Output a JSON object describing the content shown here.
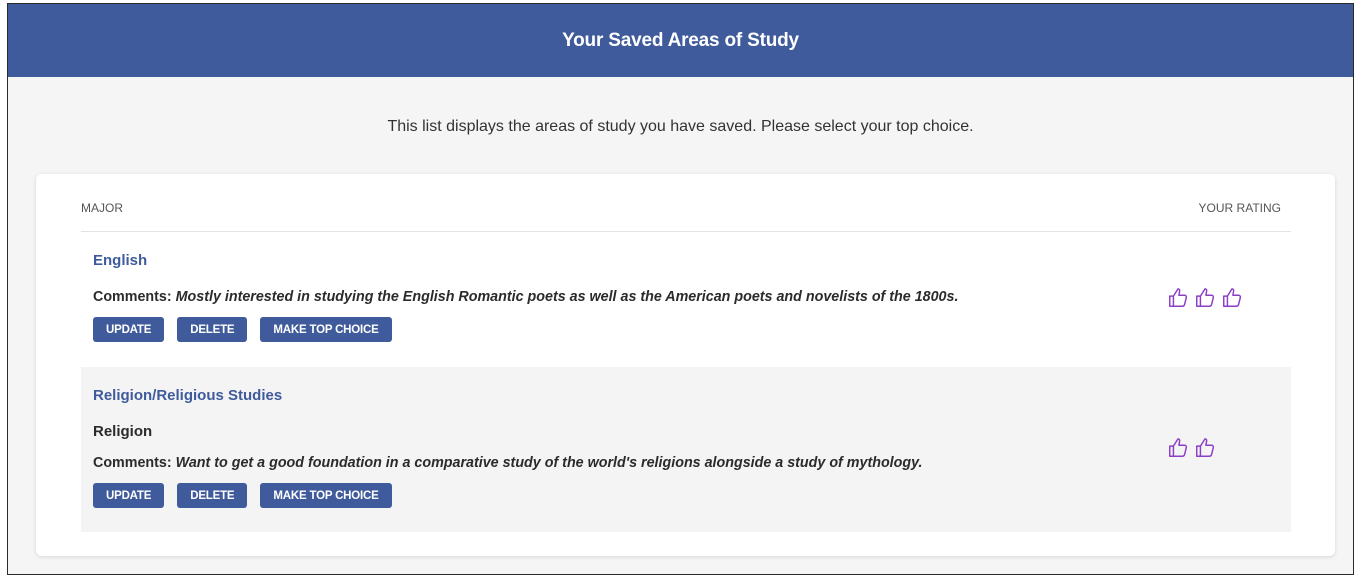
{
  "header": {
    "title": "Your Saved Areas of Study"
  },
  "intro": "This list displays the areas of study you have saved. Please select your top choice.",
  "table": {
    "col_major": "MAJOR",
    "col_rating": "YOUR RATING"
  },
  "rows": [
    {
      "major": "English",
      "comments_label": "Comments:",
      "comments": "Mostly interested in studying the English Romantic poets as well as the American poets and novelists of the 1800s.",
      "rating": 3
    },
    {
      "major": "Religion/Religious Studies",
      "subtitle": "Religion",
      "comments_label": "Comments:",
      "comments": "Want to get a good foundation in a comparative study of the world's religions alongside a study of mythology.",
      "rating": 2
    }
  ],
  "buttons": {
    "update": "UPDATE",
    "delete": "DELETE",
    "top_choice": "MAKE TOP CHOICE"
  },
  "colors": {
    "accent": "#3f5b9c",
    "thumb": "#8b3fc6"
  },
  "icons": {
    "rating": "thumbs-up-icon"
  }
}
